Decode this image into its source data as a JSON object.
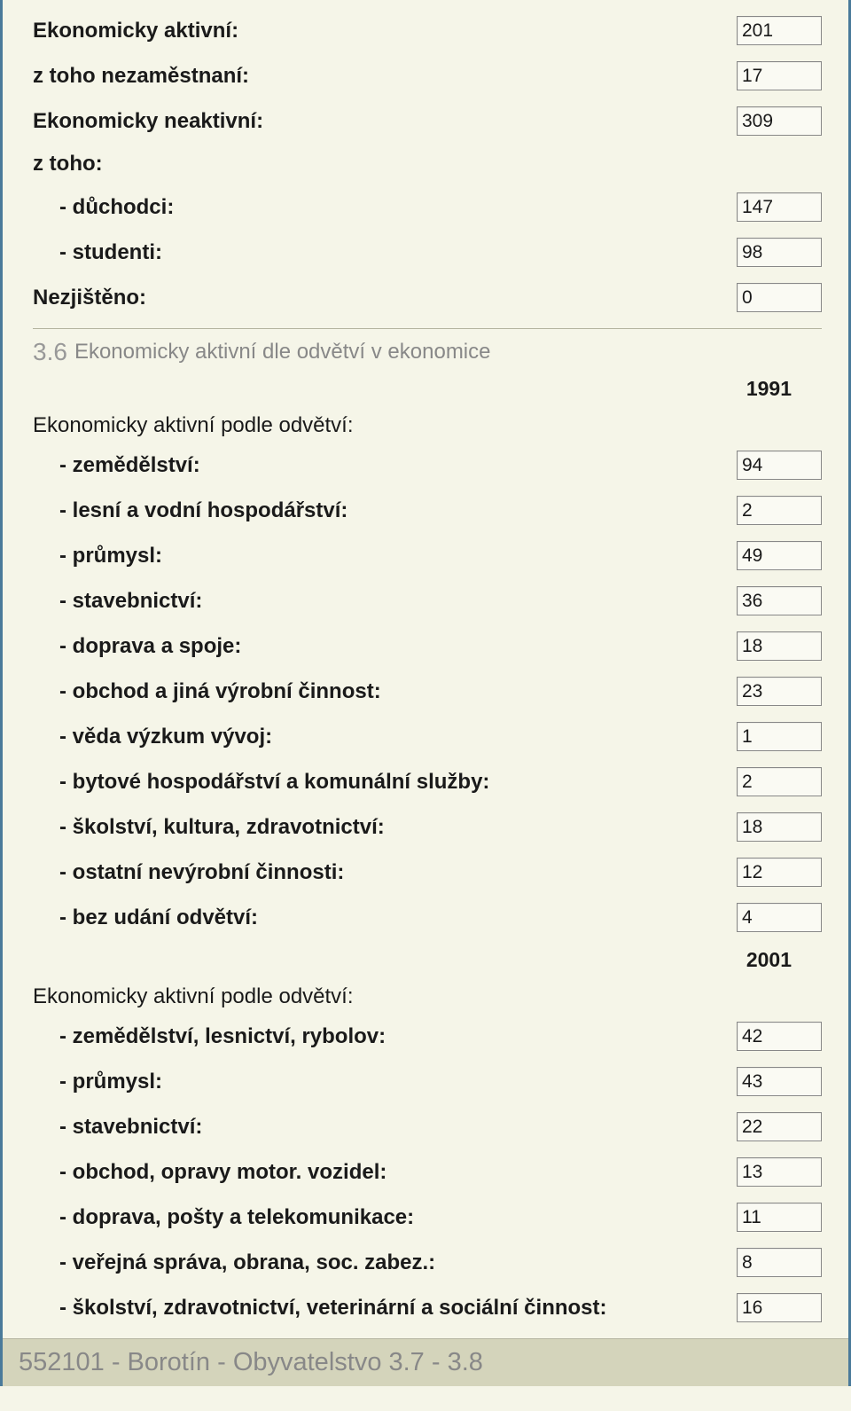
{
  "section1": {
    "rows": [
      {
        "label": "Ekonomicky aktivní:",
        "value": "201",
        "indent": false
      },
      {
        "label": "z toho nezaměstnaní:",
        "value": "17",
        "indent": false
      },
      {
        "label": "Ekonomicky neaktivní:",
        "value": "309",
        "indent": false
      },
      {
        "label": "z toho:",
        "value": null,
        "indent": false
      },
      {
        "label": "- důchodci:",
        "value": "147",
        "indent": true
      },
      {
        "label": "- studenti:",
        "value": "98",
        "indent": true
      },
      {
        "label": "Nezjištěno:",
        "value": "0",
        "indent": false
      }
    ]
  },
  "section2": {
    "heading_number": "3.6",
    "heading_title": "Ekonomicky aktivní dle odvětví v ekonomice",
    "year_1991": "1991",
    "subhead1": "Ekonomicky aktivní podle odvětví:",
    "rows1": [
      {
        "label": "- zemědělství:",
        "value": "94"
      },
      {
        "label": "- lesní a vodní hospodářství:",
        "value": "2"
      },
      {
        "label": "- průmysl:",
        "value": "49"
      },
      {
        "label": "- stavebnictví:",
        "value": "36"
      },
      {
        "label": "- doprava a spoje:",
        "value": "18"
      },
      {
        "label": "- obchod a jiná výrobní činnost:",
        "value": "23"
      },
      {
        "label": "- věda výzkum vývoj:",
        "value": "1"
      },
      {
        "label": "- bytové hospodářství a komunální služby:",
        "value": "2"
      },
      {
        "label": "- školství, kultura, zdravotnictví:",
        "value": "18"
      },
      {
        "label": "- ostatní nevýrobní činnosti:",
        "value": "12"
      },
      {
        "label": "- bez udání odvětví:",
        "value": "4"
      }
    ],
    "year_2001": "2001",
    "subhead2": "Ekonomicky aktivní podle odvětví:",
    "rows2": [
      {
        "label": "- zemědělství, lesnictví, rybolov:",
        "value": "42"
      },
      {
        "label": "- průmysl:",
        "value": "43"
      },
      {
        "label": "- stavebnictví:",
        "value": "22"
      },
      {
        "label": "- obchod, opravy motor. vozidel:",
        "value": "13"
      },
      {
        "label": "- doprava, pošty a telekomunikace:",
        "value": "11"
      },
      {
        "label": "- veřejná správa, obrana, soc. zabez.:",
        "value": "8"
      },
      {
        "label": "- školství, zdravotnictví, veterinární a sociální činnost:",
        "value": "16"
      }
    ]
  },
  "footer": "552101 - Borotín - Obyvatelstvo 3.7 - 3.8"
}
